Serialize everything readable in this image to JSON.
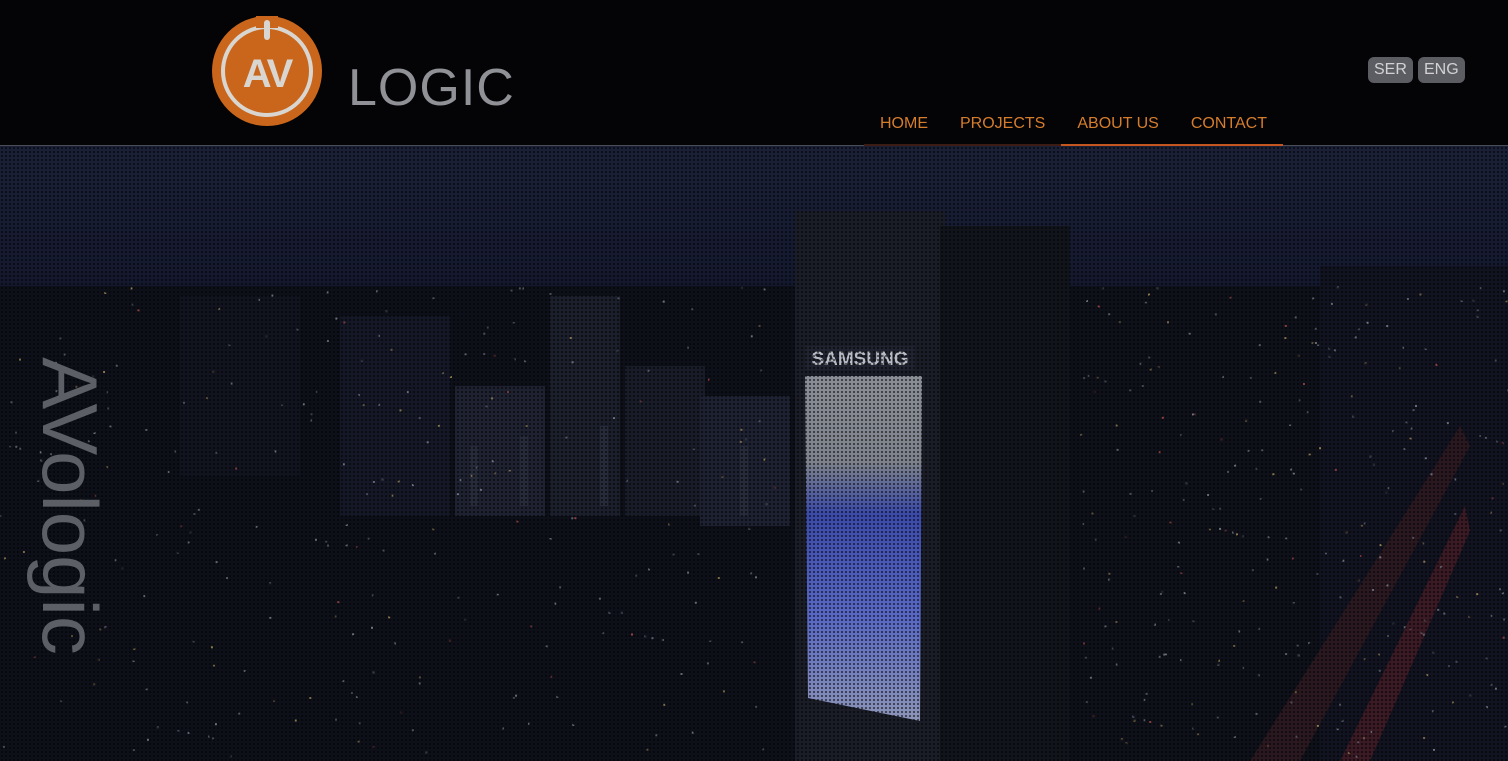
{
  "brand": {
    "logo_text": "AV",
    "name": "LOGIC",
    "vertical_text": "AVologic"
  },
  "languages": [
    {
      "label": "SER"
    },
    {
      "label": "ENG"
    }
  ],
  "nav": [
    {
      "label": "HOME"
    },
    {
      "label": "PROJECTS"
    },
    {
      "label": "ABOUT US"
    },
    {
      "label": "CONTACT"
    }
  ],
  "hero": {
    "billboard_brand": "SAMSUNG"
  },
  "colors": {
    "accent": "#d67d2c",
    "logo": "#c9661b",
    "header_bg": "#040407"
  }
}
